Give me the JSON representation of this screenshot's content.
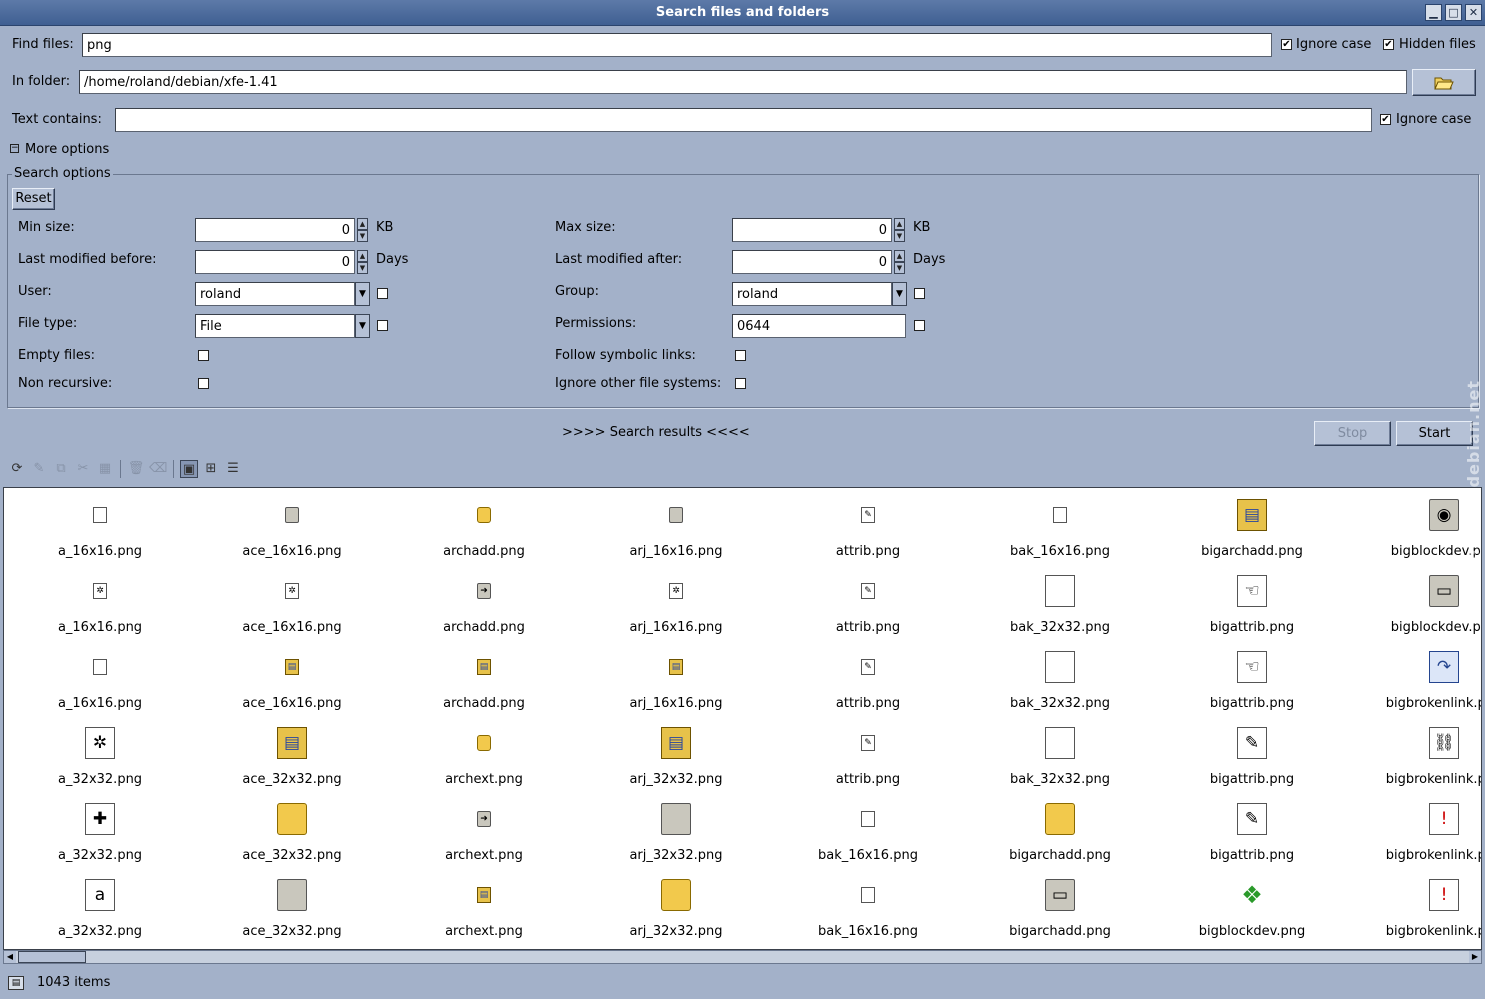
{
  "window": {
    "title": "Search files and folders",
    "buttons": [
      "▁",
      "□",
      "✕"
    ]
  },
  "find": {
    "find_files_label": "Find files:",
    "find_files_value": "png",
    "ignore_case_label": "Ignore case",
    "ignore_case_checked": true,
    "hidden_files_label": "Hidden files",
    "hidden_files_checked": true,
    "in_folder_label": "In folder:",
    "in_folder_value": "/home/roland/debian/xfe-1.41",
    "text_contains_label": "Text contains:",
    "text_contains_value": "",
    "text_ignore_case_label": "Ignore case",
    "text_ignore_case_checked": true,
    "more_options_label": "More options"
  },
  "options": {
    "group_title": "Search options",
    "reset_label": "Reset",
    "min_size_label": "Min size:",
    "min_size_value": "0",
    "min_size_unit": "KB",
    "max_size_label": "Max size:",
    "max_size_value": "0",
    "max_size_unit": "KB",
    "mod_before_label": "Last modified before:",
    "mod_before_value": "0",
    "mod_before_unit": "Days",
    "mod_after_label": "Last modified after:",
    "mod_after_value": "0",
    "mod_after_unit": "Days",
    "user_label": "User:",
    "user_value": "roland",
    "group_label": "Group:",
    "group_value": "roland",
    "file_type_label": "File type:",
    "file_type_value": "File",
    "permissions_label": "Permissions:",
    "permissions_value": "0644",
    "empty_files_label": "Empty files:",
    "follow_links_label": "Follow symbolic links:",
    "non_recursive_label": "Non recursive:",
    "ignore_fs_label": "Ignore other file systems:"
  },
  "results": {
    "header": ">>>> Search results <<<<",
    "stop_label": "Stop",
    "start_label": "Start",
    "items": [
      {
        "name": "a_16x16.png",
        "icon": "doc-small",
        "big": false
      },
      {
        "name": "ace_16x16.png",
        "icon": "box-small",
        "big": false
      },
      {
        "name": "archadd.png",
        "icon": "gold-small",
        "big": false
      },
      {
        "name": "arj_16x16.png",
        "icon": "box-small",
        "big": false
      },
      {
        "name": "attrib.png",
        "icon": "attrib-small",
        "big": false
      },
      {
        "name": "bak_16x16.png",
        "icon": "doc-small",
        "big": false
      },
      {
        "name": "bigarchadd.png",
        "icon": "archive-big",
        "big": true
      },
      {
        "name": "bigblockdev.png",
        "icon": "disk-big",
        "big": true
      },
      {
        "name": "a_16x16.png",
        "icon": "gear-small",
        "big": false
      },
      {
        "name": "ace_16x16.png",
        "icon": "gear-small",
        "big": false
      },
      {
        "name": "archadd.png",
        "icon": "arrow-small",
        "big": false
      },
      {
        "name": "arj_16x16.png",
        "icon": "gear-small",
        "big": false
      },
      {
        "name": "attrib.png",
        "icon": "attrib-small",
        "big": false
      },
      {
        "name": "bak_32x32.png",
        "icon": "doc-big",
        "big": true
      },
      {
        "name": "bigattrib.png",
        "icon": "hand-big",
        "big": true
      },
      {
        "name": "bigblockdev.png",
        "icon": "drive-big",
        "big": true
      },
      {
        "name": "a_16x16.png",
        "icon": "doc-small",
        "big": false
      },
      {
        "name": "ace_16x16.png",
        "icon": "archive-small",
        "big": false
      },
      {
        "name": "archadd.png",
        "icon": "archive-small",
        "big": false
      },
      {
        "name": "arj_16x16.png",
        "icon": "archive-small",
        "big": false
      },
      {
        "name": "attrib.png",
        "icon": "attrib-small",
        "big": false
      },
      {
        "name": "bak_32x32.png",
        "icon": "doc-big",
        "big": true
      },
      {
        "name": "bigattrib.png",
        "icon": "hand-big",
        "big": true
      },
      {
        "name": "bigbrokenlink.png",
        "icon": "link-big",
        "big": true
      },
      {
        "name": "a_32x32.png",
        "icon": "gear-big",
        "big": true
      },
      {
        "name": "ace_32x32.png",
        "icon": "archive-big",
        "big": true
      },
      {
        "name": "archext.png",
        "icon": "gold-small",
        "big": false
      },
      {
        "name": "arj_32x32.png",
        "icon": "archive-big",
        "big": true
      },
      {
        "name": "attrib.png",
        "icon": "attrib-small",
        "big": false
      },
      {
        "name": "bak_32x32.png",
        "icon": "doc-big",
        "big": true
      },
      {
        "name": "bigattrib.png",
        "icon": "attrib-big",
        "big": true
      },
      {
        "name": "bigbrokenlink.png",
        "icon": "chain-big",
        "big": true
      },
      {
        "name": "a_32x32.png",
        "icon": "puzzle-big",
        "big": true
      },
      {
        "name": "ace_32x32.png",
        "icon": "gold-big",
        "big": true
      },
      {
        "name": "archext.png",
        "icon": "arrow-small",
        "big": false
      },
      {
        "name": "arj_32x32.png",
        "icon": "box-big",
        "big": true
      },
      {
        "name": "bak_16x16.png",
        "icon": "doc-small",
        "big": false
      },
      {
        "name": "bigarchadd.png",
        "icon": "gold-big",
        "big": true
      },
      {
        "name": "bigattrib.png",
        "icon": "attrib-big",
        "big": true
      },
      {
        "name": "bigbrokenlink.png",
        "icon": "brokenlink-big",
        "big": true
      },
      {
        "name": "a_32x32.png",
        "icon": "letter-big",
        "big": true
      },
      {
        "name": "ace_32x32.png",
        "icon": "box-big",
        "big": true
      },
      {
        "name": "archext.png",
        "icon": "archive-small",
        "big": false
      },
      {
        "name": "arj_32x32.png",
        "icon": "gold-big",
        "big": true
      },
      {
        "name": "bak_16x16.png",
        "icon": "doc-small",
        "big": false
      },
      {
        "name": "bigarchadd.png",
        "icon": "drive-big",
        "big": true
      },
      {
        "name": "bigblockdev.png",
        "icon": "cubes-big",
        "big": true
      },
      {
        "name": "bigbrokenlink.png",
        "icon": "brokenlink-big",
        "big": true
      }
    ]
  },
  "status": {
    "count_text": "1043 items"
  },
  "watermark": "screenshots.debian.net"
}
